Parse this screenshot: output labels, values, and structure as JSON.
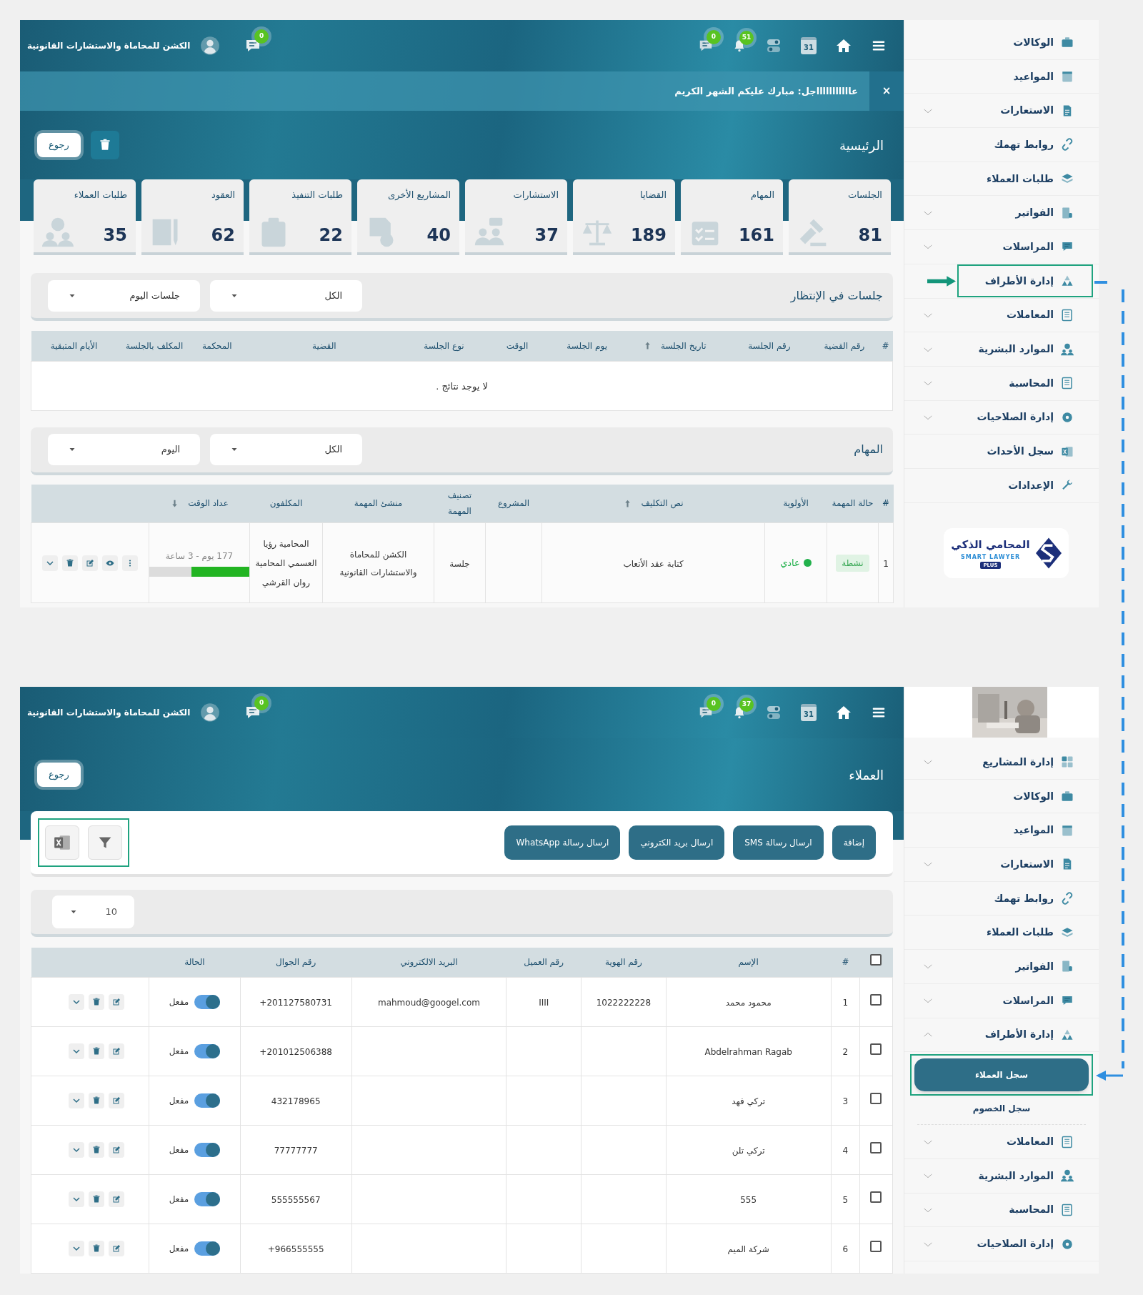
{
  "dashboard": {
    "header": {
      "company": "الكشن للمحاماة والاستشارات القانونية",
      "chat_badge": "0",
      "message_badge": "0",
      "notification_badge": "51",
      "calendar_day": "31"
    },
    "banner": {
      "text": "عاااااااااااجل: مبارك عليكم الشهر الكريم",
      "close": "×"
    },
    "title": "الرئيسية",
    "back_button": "رجوع",
    "stat_cards": [
      {
        "label": "الجلسات",
        "value": "81"
      },
      {
        "label": "المهام",
        "value": "161"
      },
      {
        "label": "القضايا",
        "value": "189"
      },
      {
        "label": "الاستشارات",
        "value": "37"
      },
      {
        "label": "المشاريع الأخرى",
        "value": "40"
      },
      {
        "label": "طلبات التنفيذ",
        "value": "22"
      },
      {
        "label": "العقود",
        "value": "62"
      },
      {
        "label": "طلبات العملاء",
        "value": "35"
      }
    ],
    "sessions": {
      "title": "جلسات في الإنتظار",
      "filters": [
        "الكل",
        "جلسات اليوم"
      ],
      "columns": [
        {
          "label": "#",
          "sorted": false
        },
        {
          "label": "رقم القضية",
          "sorted": false
        },
        {
          "label": "رقم الجلسة",
          "sorted": false
        },
        {
          "label": "تاريخ الجلسة",
          "sorted": true,
          "descending": false
        },
        {
          "label": "يوم الجلسة",
          "sorted": false
        },
        {
          "label": "الوقت",
          "sorted": false
        },
        {
          "label": "نوع الجلسة",
          "sorted": false
        },
        {
          "label": "القضية",
          "sorted": false
        },
        {
          "label": "المحكمة",
          "sorted": false
        },
        {
          "label": "المكلف بالجلسة",
          "sorted": false
        },
        {
          "label": "الأيام المتبقية",
          "sorted": false
        }
      ],
      "empty_message": "لا يوجد نتائج ."
    },
    "tasks": {
      "title": "المهام",
      "filters": [
        "الكل",
        "اليوم"
      ],
      "columns": [
        {
          "label": "#",
          "sorted": false
        },
        {
          "label": "حالة المهمة",
          "sorted": false
        },
        {
          "label": "الأولوية",
          "sorted": false
        },
        {
          "label": "نص التكليف",
          "sorted": true,
          "descending": false
        },
        {
          "label": "المشروع",
          "sorted": false
        },
        {
          "label": "تصنيف المهمة",
          "sorted": false
        },
        {
          "label": "منشئ المهمة",
          "sorted": false
        },
        {
          "label": "المكلفون",
          "sorted": false
        },
        {
          "label": "عداد الوقت",
          "sorted": true,
          "descending": true
        }
      ],
      "rows": [
        {
          "num": "1",
          "status": "نشطة",
          "priority": "عادي",
          "color": "#22b14c",
          "text": "كتابة عقد الأتعاب",
          "category": "جلسة",
          "creator": "الكشن للمحاماة والاستشارات القانونية",
          "assignees": "المحامية رؤيا العسمي المحامية روان القرشي",
          "timer": "177 يوم - 3 ساعة",
          "level": 0.58
        }
      ]
    },
    "sidebar": {
      "items": [
        {
          "label": "الوكالات",
          "expandable": false,
          "expanded": false,
          "highlighted": false
        },
        {
          "label": "المواعيد",
          "expandable": false,
          "expanded": false,
          "highlighted": false
        },
        {
          "label": "الاستعارات",
          "expandable": true,
          "expanded": false,
          "highlighted": false
        },
        {
          "label": "روابط تهمك",
          "expandable": false,
          "expanded": false,
          "highlighted": false
        },
        {
          "label": "طلبات العملاء",
          "expandable": false,
          "expanded": false,
          "highlighted": false
        },
        {
          "label": "الفواتير",
          "expandable": true,
          "expanded": false,
          "highlighted": false
        },
        {
          "label": "المراسلات",
          "expandable": true,
          "expanded": false,
          "highlighted": false
        },
        {
          "label": "إدارة الأطراف",
          "expandable": false,
          "expanded": false,
          "highlighted": true
        },
        {
          "label": "المعاملات",
          "expandable": true,
          "expanded": false,
          "highlighted": false
        },
        {
          "label": "الموارد البشرية",
          "expandable": true,
          "expanded": false,
          "highlighted": false
        },
        {
          "label": "المحاسبة",
          "expandable": true,
          "expanded": false,
          "highlighted": false
        },
        {
          "label": "إدارة الصلاحيات",
          "expandable": true,
          "expanded": false,
          "highlighted": false
        },
        {
          "label": "سجل الأحداث",
          "expandable": false,
          "expanded": false,
          "highlighted": false
        },
        {
          "label": "الإعدادات",
          "expandable": false,
          "expanded": false,
          "highlighted": false
        }
      ],
      "logo": {
        "arabic": "المحامي الذكي",
        "english": "SMART LAWYER",
        "badge": "PLUS"
      }
    }
  },
  "clients": {
    "header": {
      "company": "الكشن للمحاماة والاستشارات القانونية",
      "chat_badge": "0",
      "message_badge": "0",
      "notification_badge": "37",
      "calendar_day": "31"
    },
    "title": "العملاء",
    "back_button": "رجوع",
    "actions": [
      "إضافة",
      "ارسال رسالة SMS",
      "ارسال بريد الكتروني",
      "ارسال رسالة WhatsApp"
    ],
    "tools_highlighted": true,
    "page_size": "10",
    "table": {
      "select_all_checked": false,
      "columns": [
        "#",
        "الإسم",
        "رقم الهوية",
        "رقم العميل",
        "البريد الالكتروني",
        "رقم الجوال",
        "الحالة"
      ],
      "rows": [
        {
          "num": "1",
          "name": "محمود محمد",
          "id_number": "1022222228",
          "client_number": "IIII",
          "email": "mahmoud@googel.com",
          "phone": "+201127580731",
          "status": "مفعل",
          "active": true,
          "checked": false
        },
        {
          "num": "2",
          "name": "Abdelrahman Ragab",
          "phone": "+201012506388",
          "status": "مفعل",
          "active": true,
          "checked": false
        },
        {
          "num": "3",
          "name": "تركي فهد",
          "phone": "432178965",
          "status": "مفعل",
          "active": true,
          "checked": false
        },
        {
          "num": "4",
          "name": "تركي تلن",
          "phone": "77777777",
          "status": "مفعل",
          "active": true,
          "checked": false
        },
        {
          "num": "5",
          "name": "555",
          "phone": "555555567",
          "status": "مفعل",
          "active": true,
          "checked": false
        },
        {
          "num": "6",
          "name": "شركة الميم",
          "phone": "+966555555",
          "status": "مفعل",
          "active": true,
          "checked": false
        }
      ]
    },
    "sidebar": {
      "items": [
        {
          "label": "إدارة المشاريع",
          "expandable": true,
          "expanded": false,
          "highlighted": false
        },
        {
          "label": "الوكالات",
          "expandable": false,
          "expanded": false,
          "highlighted": false
        },
        {
          "label": "المواعيد",
          "expandable": false,
          "expanded": false,
          "highlighted": false
        },
        {
          "label": "الاستعارات",
          "expandable": true,
          "expanded": false,
          "highlighted": false
        },
        {
          "label": "روابط تهمك",
          "expandable": false,
          "expanded": false,
          "highlighted": false
        },
        {
          "label": "طلبات العملاء",
          "expandable": false,
          "expanded": false,
          "highlighted": false
        },
        {
          "label": "الفواتير",
          "expandable": true,
          "expanded": false,
          "highlighted": false
        },
        {
          "label": "المراسلات",
          "expandable": true,
          "expanded": false,
          "highlighted": false
        },
        {
          "label": "إدارة الأطراف",
          "expandable": true,
          "expanded": true,
          "highlighted": false,
          "children": [
            {
              "label": "سجل العملاء",
              "selected": true,
              "highlighted": true
            },
            {
              "label": "سجل الخصوم",
              "selected": false,
              "highlighted": false
            }
          ]
        },
        {
          "label": "المعاملات",
          "expandable": true,
          "expanded": false,
          "highlighted": false
        },
        {
          "label": "الموارد البشرية",
          "expandable": true,
          "expanded": false,
          "highlighted": false
        },
        {
          "label": "المحاسبة",
          "expandable": true,
          "expanded": false,
          "highlighted": false
        },
        {
          "label": "إدارة الصلاحيات",
          "expandable": true,
          "expanded": false,
          "highlighted": false
        }
      ]
    }
  }
}
